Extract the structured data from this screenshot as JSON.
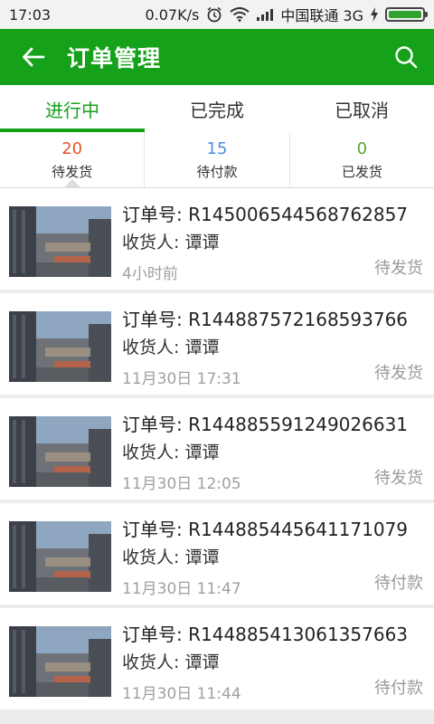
{
  "status_bar": {
    "time": "17:03",
    "speed": "0.07K/s",
    "carrier": "中国联通 3G"
  },
  "app_bar": {
    "title": "订单管理"
  },
  "tabs": [
    {
      "label": "进行中",
      "active": true
    },
    {
      "label": "已完成",
      "active": false
    },
    {
      "label": "已取消",
      "active": false
    }
  ],
  "substatus": [
    {
      "count": "20",
      "label": "待发货",
      "color": "#e8542b"
    },
    {
      "count": "15",
      "label": "待付款",
      "color": "#4a90e2"
    },
    {
      "count": "0",
      "label": "已发货",
      "color": "#5aa531"
    }
  ],
  "orders": [
    {
      "order_no": "订单号: R145006544568762857",
      "receiver": "收货人: 谭谭",
      "time": "4小时前",
      "status": "待发货"
    },
    {
      "order_no": "订单号: R144887572168593766",
      "receiver": "收货人: 谭谭",
      "time": "11月30日 17:31",
      "status": "待发货"
    },
    {
      "order_no": "订单号: R144885591249026631",
      "receiver": "收货人: 谭谭",
      "time": "11月30日 12:05",
      "status": "待发货"
    },
    {
      "order_no": "订单号: R144885445641171079",
      "receiver": "收货人: 谭谭",
      "time": "11月30日 11:47",
      "status": "待付款"
    },
    {
      "order_no": "订单号: R144885413061357663",
      "receiver": "收货人: 谭谭",
      "time": "11月30日 11:44",
      "status": "待付款"
    }
  ],
  "colors": {
    "brand": "#15a21a"
  }
}
